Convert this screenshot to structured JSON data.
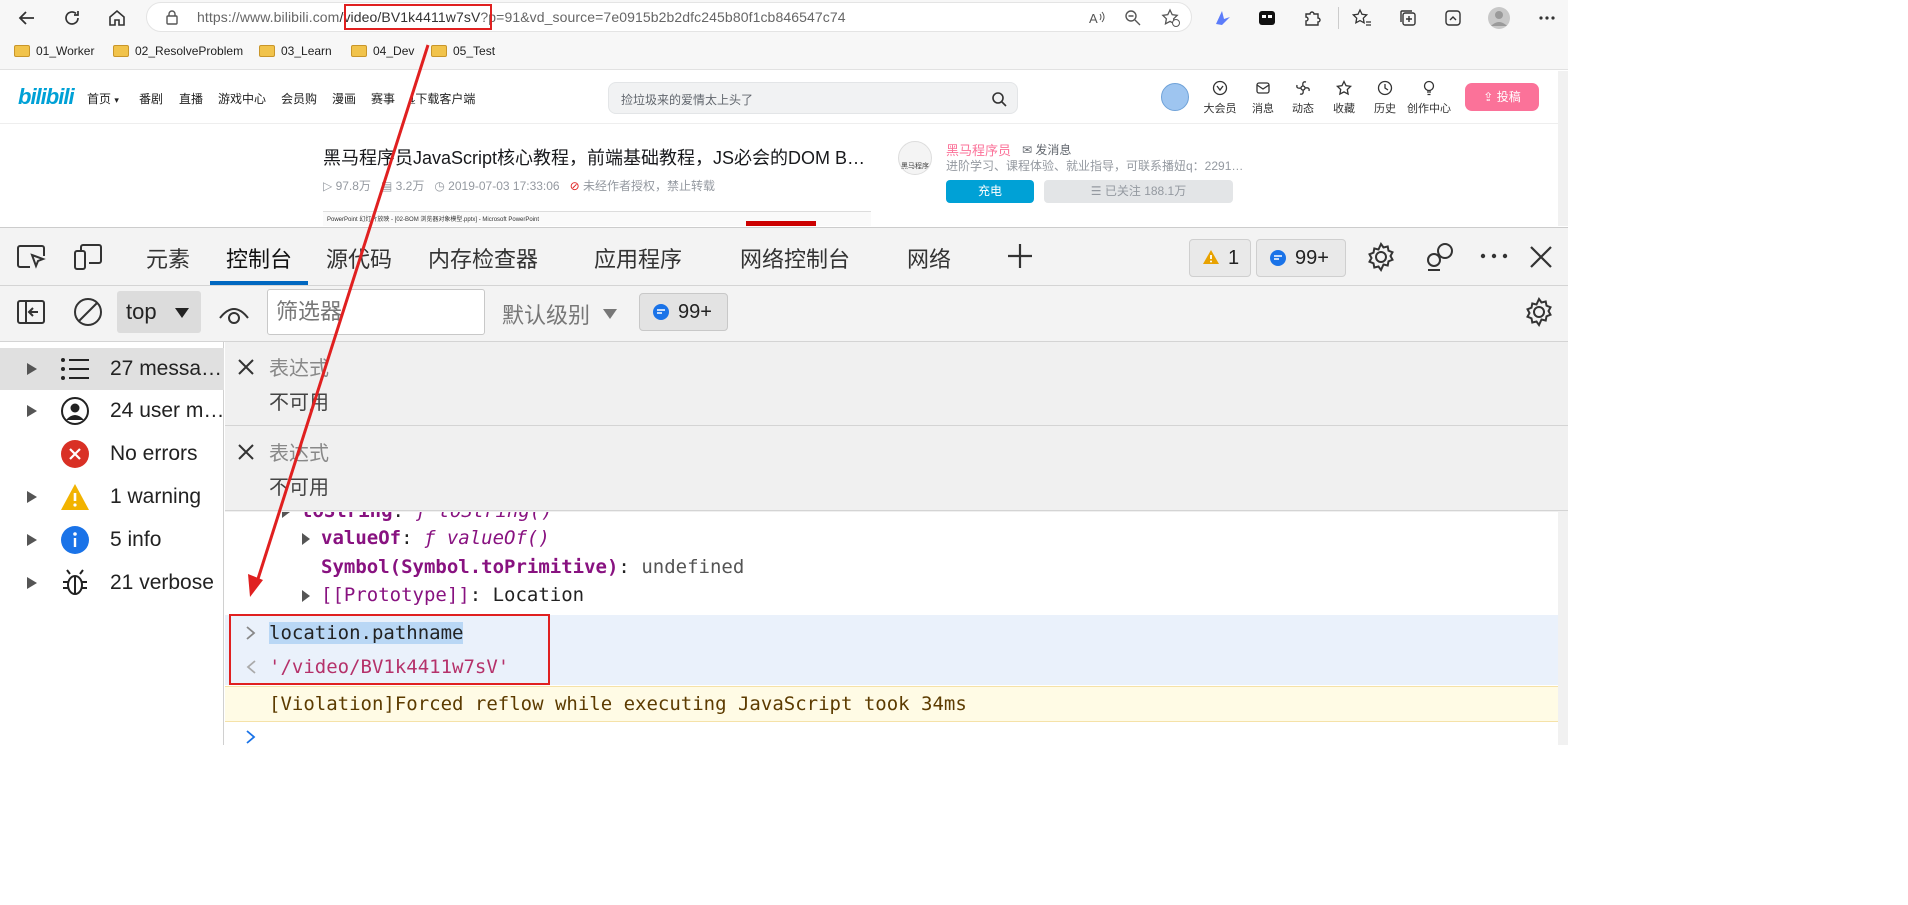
{
  "browser": {
    "url_prefix": "https://www.bilibili.com",
    "url_highlight": "/video/BV1k4411w7sV",
    "url_suffix": "?p=91&vd_source=7e0915b2b2dfc245b80f1cb846547c74",
    "favorites": [
      "01_Worker",
      "02_ResolveProblem",
      "03_Learn",
      "04_Dev",
      "05_Test"
    ]
  },
  "bilibili": {
    "logo": "bilibili",
    "nav": [
      "首页",
      "番剧",
      "直播",
      "游戏中心",
      "会员购",
      "漫画",
      "赛事",
      "下载客户端"
    ],
    "search_placeholder": "捡垃圾来的爱情太上头了",
    "right_items": [
      "大会员",
      "消息",
      "动态",
      "收藏",
      "历史",
      "创作中心"
    ],
    "upload_label": "投稿",
    "video_title": "黑马程序员JavaScript核心教程，前端基础教程，JS必会的DOM B…",
    "views": "97.8万",
    "danmaku": "3.2万",
    "date": "2019-07-03 17:33:06",
    "copyright": "未经作者授权，禁止转载",
    "uploader_name": "黑马程序员",
    "send_message": "发消息",
    "uploader_desc": "进阶学习、课程体验、就业指导，可联系播妞q：2291…",
    "avatar_text": "黑马程序",
    "charge_label": "充电",
    "follow_label": "已关注 188.1万",
    "thumb_caption": "PowerPoint 幻灯片放映 - [02-BOM 浏览器对象模型.pptx] - Microsoft PowerPoint"
  },
  "devtools": {
    "tabs": [
      "元素",
      "控制台",
      "源代码",
      "内存检查器",
      "应用程序",
      "网络控制台",
      "网络"
    ],
    "active_tab": "控制台",
    "warning_count": "1",
    "message_count": "99+",
    "context": "top",
    "filter_placeholder": "筛选器",
    "levels_label": "默认级别",
    "message_count_2": "99+",
    "sidebar": [
      {
        "label": "27 messa…",
        "icon": "list-icon"
      },
      {
        "label": "24 user m…",
        "icon": "user-icon"
      },
      {
        "label": "No errors",
        "icon": "error-icon"
      },
      {
        "label": "1 warning",
        "icon": "warning-icon"
      },
      {
        "label": "5 info",
        "icon": "info-icon"
      },
      {
        "label": "21 verbose",
        "icon": "bug-icon"
      }
    ],
    "live_expressions": [
      {
        "label": "表达式",
        "value": "不可用"
      },
      {
        "label": "表达式",
        "value": "不可用"
      }
    ],
    "console": {
      "line_tostring_key": "toString",
      "line_tostring_val": "ƒ toString()",
      "line_valueof_key": "valueOf",
      "line_valueof_val": "ƒ valueOf()",
      "line_symbol_key": "Symbol(Symbol.toPrimitive)",
      "line_symbol_val": "undefined",
      "line_proto_key": "[[Prototype]]",
      "line_proto_val": "Location",
      "command": "location.pathname",
      "result": "'/video/BV1k4411w7sV'",
      "violation": "[Violation]Forced reflow while executing JavaScript took 34ms"
    }
  },
  "annotation_color": "#e02020"
}
